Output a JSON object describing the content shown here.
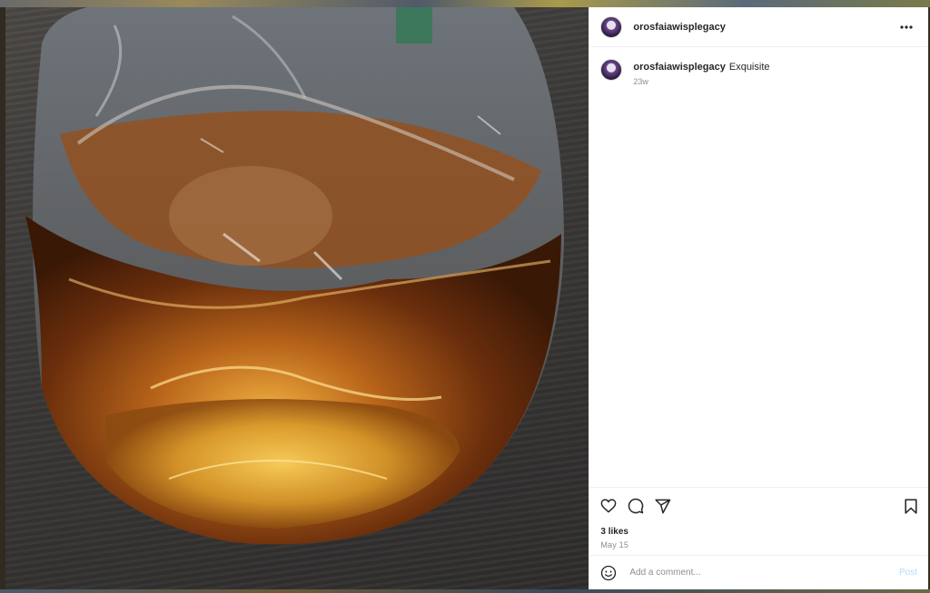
{
  "post": {
    "username": "orosfaiawisplegacy",
    "caption_user": "orosfaiawisplegacy",
    "caption_text": "Exquisite",
    "caption_time": "23w",
    "likes_text": "3 likes",
    "date_text": "May 15"
  },
  "icons": {
    "more": "more-horizontal-icon",
    "like": "heart-icon",
    "comment": "comment-bubble-icon",
    "share": "paper-plane-icon",
    "save": "bookmark-icon",
    "emoji": "smiley-icon"
  },
  "composer": {
    "placeholder": "Add a comment...",
    "post_label": "Post"
  },
  "colors": {
    "text": "#262626",
    "muted": "#8e8e8e",
    "post_disabled": "#b2dffc",
    "border": "#efefef"
  }
}
